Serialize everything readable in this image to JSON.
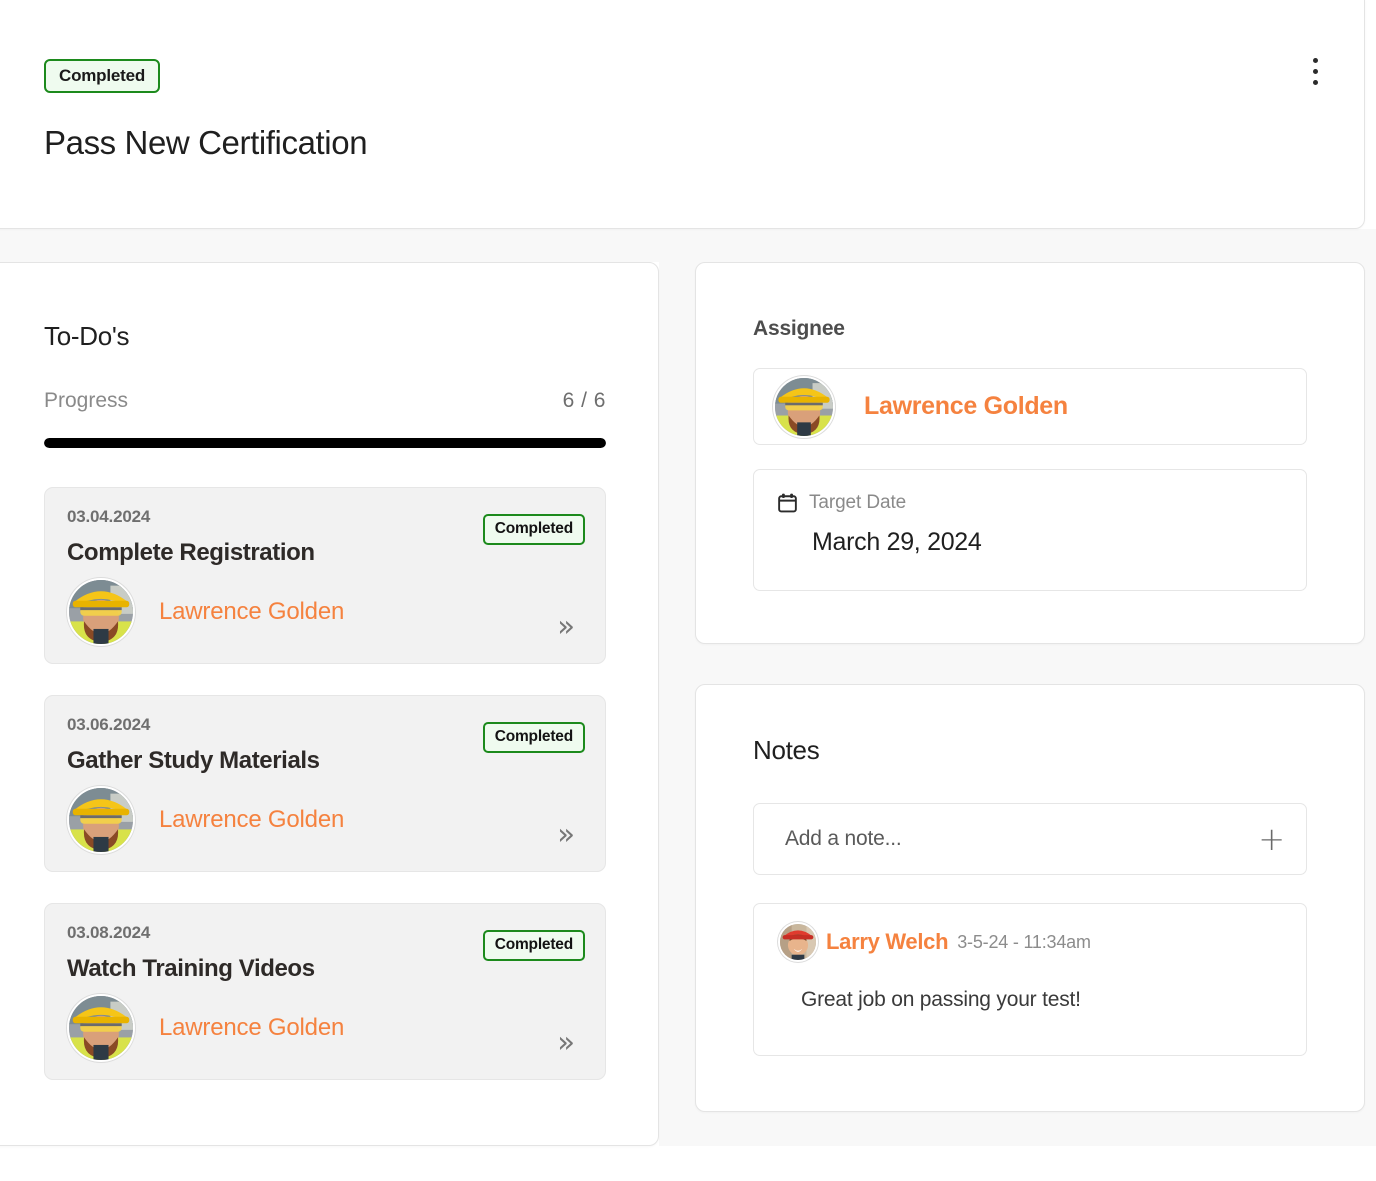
{
  "header": {
    "status_badge": "Completed",
    "title": "Pass New Certification",
    "menu_icon": "kebab-menu-icon"
  },
  "todos_panel": {
    "title": "To-Do's",
    "progress_label": "Progress",
    "progress_count": "6 / 6",
    "progress_completed": 6,
    "progress_total": 6,
    "progress_percent": 100,
    "items": [
      {
        "date": "03.04.2024",
        "status": "Completed",
        "name": "Complete Registration",
        "assignee": "Lawrence Golden",
        "open_icon": "»"
      },
      {
        "date": "03.06.2024",
        "status": "Completed",
        "name": "Gather Study Materials",
        "assignee": "Lawrence Golden",
        "open_icon": "»"
      },
      {
        "date": "03.08.2024",
        "status": "Completed",
        "name": "Watch Training Videos",
        "assignee": "Lawrence Golden",
        "open_icon": "»"
      }
    ]
  },
  "assignee_panel": {
    "label": "Assignee",
    "name": "Lawrence Golden",
    "target_date_label": "Target Date",
    "target_date_value": "March 29, 2024",
    "calendar_icon": "calendar-icon"
  },
  "notes_panel": {
    "title": "Notes",
    "add_note_placeholder": "Add a note...",
    "add_note_value": "",
    "add_icon": "+",
    "notes": [
      {
        "author": "Larry Welch",
        "timestamp": "3-5-24 - 11:34am",
        "body": "Great job on passing your test!"
      }
    ]
  },
  "colors": {
    "accent_orange": "#F5823F",
    "status_green_border": "#1C8A1C",
    "status_green_bg": "#EFFBEF",
    "progress_fill": "#000000",
    "page_bg": "#FFFFFF",
    "panel_bg": "#F8F8F8"
  }
}
